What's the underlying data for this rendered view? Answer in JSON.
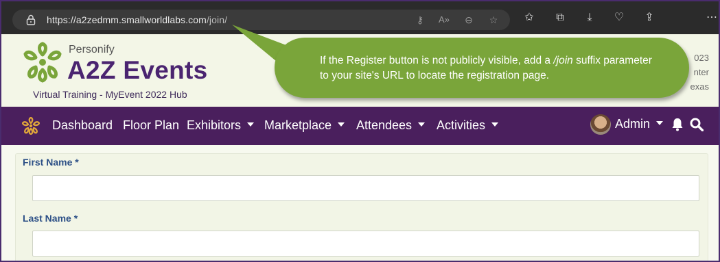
{
  "browser": {
    "url_host": "https://a2zedmm.smallworldlabs.com",
    "url_path": "/join/",
    "icons": [
      "lock-icon",
      "key-icon",
      "read-aloud-icon",
      "zoom-out-icon",
      "favorite-add-icon",
      "favorites-icon",
      "collections-icon",
      "downloads-icon",
      "browser-essentials-icon",
      "share-icon",
      "more-icon"
    ]
  },
  "header": {
    "personify": "Personify",
    "brand": "A2Z Events",
    "subtitle": "Virtual Training - MyEvent 2022 Hub",
    "right_info_line1": "023",
    "right_info_line2": "nter",
    "right_info_line3": "exas"
  },
  "callout": {
    "text_before": "If the Register button is not publicly visible, add a ",
    "text_em": "/join",
    "text_after": " suffix parameter to your site's URL to locate the registration page."
  },
  "nav": {
    "items": [
      {
        "label": "Dashboard"
      },
      {
        "label": "Floor Plan"
      },
      {
        "label": "Exhibitors"
      },
      {
        "label": "Marketplace"
      },
      {
        "label": "Attendees"
      },
      {
        "label": "Activities"
      }
    ],
    "user": "Admin"
  },
  "form": {
    "first_name_label": "First Name *",
    "first_name_value": "",
    "last_name_label": "Last Name *",
    "last_name_value": ""
  },
  "colors": {
    "nav_bg": "#4a1f5d",
    "brand_purple": "#4a2470",
    "callout_green": "#7aa53a",
    "label_blue": "#2c4f86",
    "logo_green": "#7aa53a",
    "logo_orange": "#e0a63a"
  }
}
